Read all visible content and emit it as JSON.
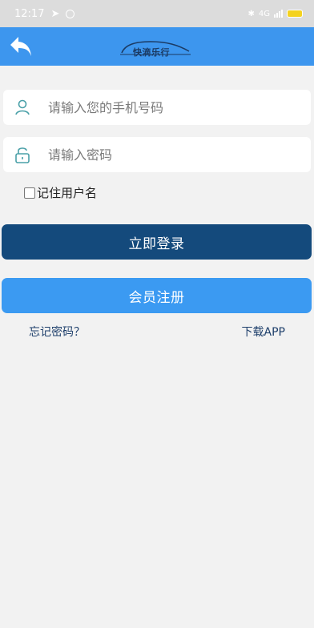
{
  "status_bar": {
    "time": "12:17",
    "network_label": "4G"
  },
  "header": {
    "logo_text": "快滴乐行",
    "colors": {
      "app_bar": "#3d96ee"
    }
  },
  "form": {
    "phone_placeholder": "请输入您的手机号码",
    "password_placeholder": "请输入密码",
    "remember_label": "记住用户名",
    "remember_checked": false
  },
  "buttons": {
    "login_label": "立即登录",
    "register_label": "会员注册",
    "colors": {
      "login": "#144a7c",
      "register": "#3b9af2"
    }
  },
  "links": {
    "forgot_label": "忘记密码？",
    "download_label": "下载APP"
  },
  "icons": [
    "back-arrow-icon",
    "user-icon",
    "lock-icon",
    "telegram-icon",
    "bluetooth-icon",
    "signal-icon",
    "battery-icon"
  ]
}
